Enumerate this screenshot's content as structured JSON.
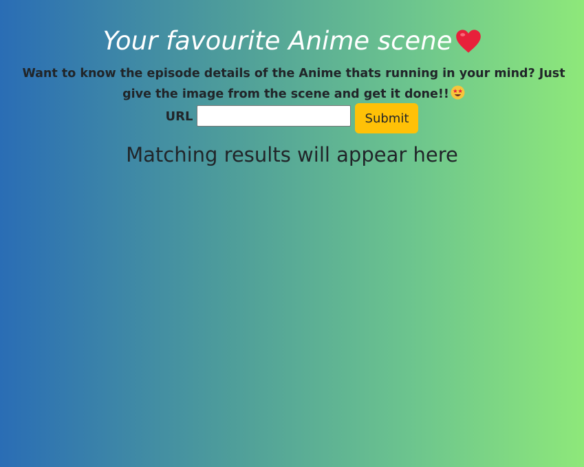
{
  "header": {
    "title": "Your favourite Anime scene",
    "title_icon": "red-heart-icon"
  },
  "intro": {
    "text": "Want to know the episode details of the Anime thats running in your mind? Just give the image from the scene and get it done!!",
    "icon": "star-struck-face-icon"
  },
  "form": {
    "url_label": "URL",
    "url_value": "",
    "url_placeholder": "",
    "submit_label": "Submit"
  },
  "results": {
    "placeholder_text": "Matching results will appear here"
  },
  "colors": {
    "gradient_start": "#2a6db5",
    "gradient_end": "#8ee87a",
    "submit_button": "#ffc107",
    "heart": "#e8203a"
  }
}
